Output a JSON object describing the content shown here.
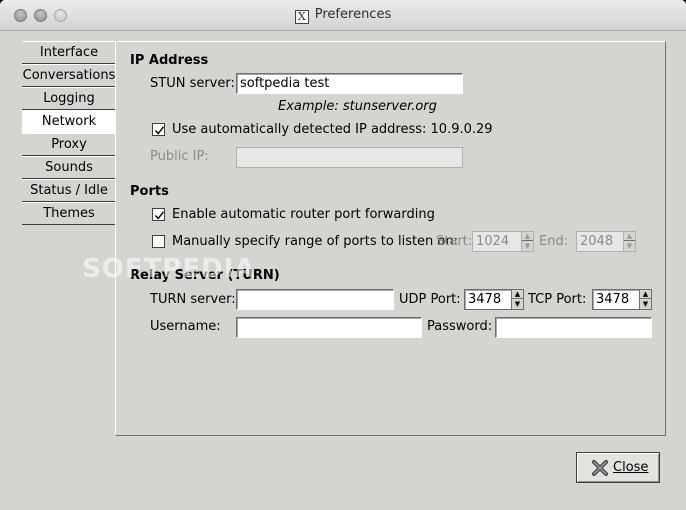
{
  "window": {
    "title": "Preferences",
    "title_icon_glyph": "X"
  },
  "sidebar": {
    "items": [
      {
        "label": "Interface",
        "active": false
      },
      {
        "label": "Conversations",
        "active": false
      },
      {
        "label": "Logging",
        "active": false
      },
      {
        "label": "Network",
        "active": true
      },
      {
        "label": "Proxy",
        "active": false
      },
      {
        "label": "Sounds",
        "active": false
      },
      {
        "label": "Status / Idle",
        "active": false
      },
      {
        "label": "Themes",
        "active": false
      }
    ]
  },
  "ip_address": {
    "heading": "IP Address",
    "stun_label": "STUN server:",
    "stun_value": "softpedia test",
    "stun_example": "Example: stunserver.org",
    "auto_detect_label": "Use automatically detected IP address: 10.9.0.29",
    "auto_detect_checked": true,
    "public_ip_label": "Public IP:",
    "public_ip_value": ""
  },
  "ports": {
    "heading": "Ports",
    "router_fwd_label": "Enable automatic router port forwarding",
    "router_fwd_checked": true,
    "manual_range_label": "Manually specify range of ports to listen on:",
    "manual_range_checked": false,
    "start_label": "Start:",
    "start_value": "1024",
    "end_label": "End:",
    "end_value": "2048"
  },
  "relay": {
    "heading": "Relay Server (TURN)",
    "turn_label": "TURN server:",
    "turn_value": "",
    "udp_label": "UDP Port:",
    "udp_value": "3478",
    "tcp_label": "TCP Port:",
    "tcp_value": "3478",
    "username_label": "Username:",
    "username_value": "",
    "password_label": "Password:",
    "password_value": ""
  },
  "footer": {
    "close_label": "Close"
  },
  "watermark": "SOFTPEDIA",
  "colors": {
    "window_bg": "#d6d4d0",
    "active_tab_bg": "#ffffff",
    "disabled_text": "#8a8a8a"
  }
}
